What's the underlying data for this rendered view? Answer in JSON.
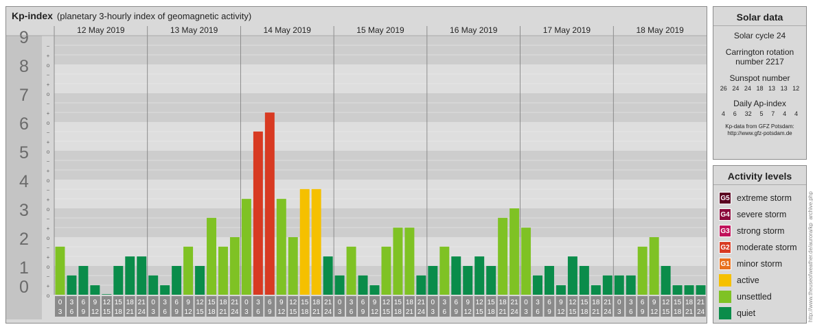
{
  "header": {
    "title": "Kp-index",
    "subtitle": "(planetary 3-hourly index of geomagnetic activity)"
  },
  "chart_data": {
    "type": "bar",
    "days": [
      "12 May 2019",
      "13 May 2019",
      "14 May 2019",
      "15 May 2019",
      "16 May 2019",
      "17 May 2019",
      "18 May 2019"
    ],
    "interval_labels": [
      [
        "0",
        "3"
      ],
      [
        "3",
        "6"
      ],
      [
        "6",
        "9"
      ],
      [
        "9",
        "12"
      ],
      [
        "12",
        "15"
      ],
      [
        "15",
        "18"
      ],
      [
        "18",
        "21"
      ],
      [
        "21",
        "24"
      ]
    ],
    "y_ticks": [
      "0",
      "1",
      "2",
      "3",
      "4",
      "5",
      "6",
      "7",
      "8",
      "9"
    ],
    "sub_ticks": [
      "−",
      "o",
      "+"
    ],
    "ylim": [
      0,
      9
    ],
    "values": [
      1.67,
      0.67,
      1.0,
      0.33,
      0.0,
      1.0,
      1.33,
      1.33,
      0.67,
      0.33,
      1.0,
      1.67,
      1.0,
      2.67,
      1.67,
      2.0,
      3.33,
      5.67,
      6.33,
      3.33,
      2.0,
      3.67,
      3.67,
      1.33,
      0.67,
      1.67,
      0.67,
      0.33,
      1.67,
      2.33,
      2.33,
      0.67,
      1.0,
      1.67,
      1.33,
      1.0,
      1.33,
      1.0,
      2.67,
      3.0,
      2.33,
      0.67,
      1.0,
      0.33,
      1.33,
      1.0,
      0.33,
      0.67,
      0.67,
      0.67,
      1.67,
      2.0,
      1.0,
      0.33,
      0.33,
      0.33
    ]
  },
  "solar": {
    "heading": "Solar data",
    "cycle": "Solar cycle 24",
    "carrington": "Carrington rotation number 2217",
    "sunspot_label": "Sunspot number",
    "sunspot_values": [
      "26",
      "24",
      "24",
      "18",
      "13",
      "13",
      "12"
    ],
    "ap_label": "Daily Ap-index",
    "ap_values": [
      "4",
      "6",
      "32",
      "5",
      "7",
      "4",
      "4"
    ],
    "source_line1": "Kp-data from GFZ Potsdam:",
    "source_line2": "http://www.gfz-potsdam.de"
  },
  "levels": {
    "heading": "Activity levels",
    "items": [
      {
        "code": "G5",
        "label": "extreme storm",
        "color": "#5a0020"
      },
      {
        "code": "G4",
        "label": "severe storm",
        "color": "#8b0a3c"
      },
      {
        "code": "G3",
        "label": "strong storm",
        "color": "#c0105a"
      },
      {
        "code": "G2",
        "label": "moderate storm",
        "color": "#d83a22"
      },
      {
        "code": "G1",
        "label": "minor storm",
        "color": "#e8701e"
      },
      {
        "code": "",
        "label": "active",
        "color": "#f5c000"
      },
      {
        "code": "",
        "label": "unsettled",
        "color": "#7fc224"
      },
      {
        "code": "",
        "label": "quiet",
        "color": "#0a8c4a"
      }
    ]
  },
  "credit": "http://www.theuseofweather.de/aurora/kp_archive.php"
}
